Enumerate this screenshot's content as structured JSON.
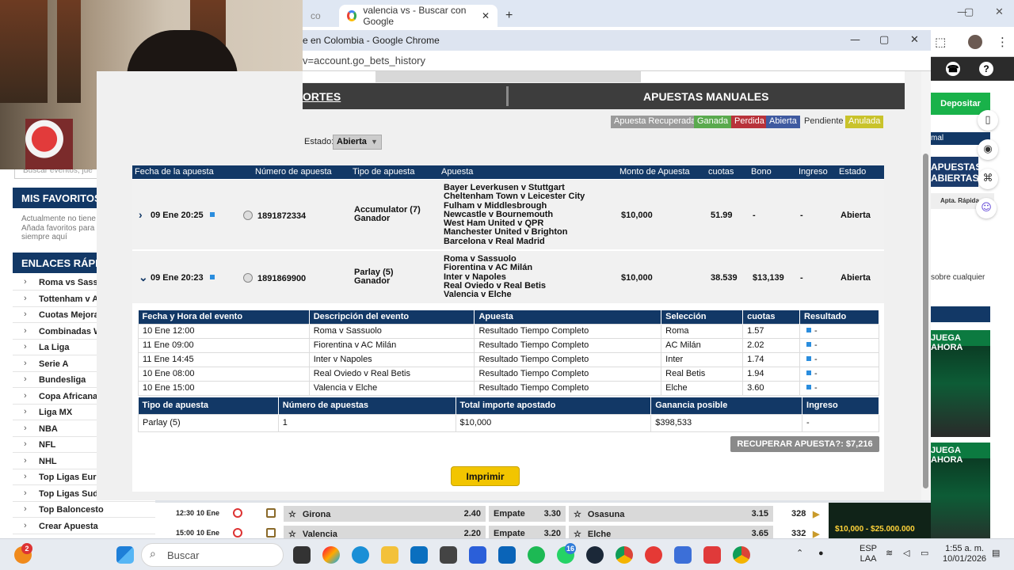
{
  "browser": {
    "tab_partial": "co",
    "tab_active_title": "valencia vs - Buscar con Google",
    "new_tab": "+",
    "win_min": "—",
    "win_max": "▢",
    "win_close": "✕"
  },
  "popup": {
    "title": "e en Colombia - Google Chrome",
    "url": "v=account.go_bets_history",
    "min": "—",
    "max": "▢",
    "close": "✕"
  },
  "site": {
    "search_placeholder": "Buscar eventos, jue",
    "favoritos_header": "MIS FAVORITOS",
    "favoritos_text": "Actualmente no tiene Añada favoritos para siempre aquí",
    "enlaces_header": "ENLACES RÁPID",
    "links": [
      "Roma vs Sassu",
      "Tottenham v As",
      "Cuotas Mejorac",
      "Combinadas W",
      "La Liga",
      "Serie A",
      "Bundesliga",
      "Copa Africana -",
      "Liga MX",
      "NBA",
      "NFL",
      "NHL",
      "Top Ligas Euro",
      "Top Ligas Suda",
      "Top Baloncesto",
      "Crear Apuesta"
    ],
    "right": {
      "phone_icon": "☎",
      "help": "?",
      "depositar": "Depositar",
      "balance_text": "mal",
      "apuestas_abiertas": "APUESTAS ABIERTAS",
      "apt_rapida": "Apta. Rápida",
      "sobre": "sobre cualquier",
      "juega_ahora_1": "JUEGA AHORA",
      "juega_ahora_2": "JUEGA AHORA"
    },
    "matches": [
      {
        "time": "12:30",
        "date": "10 Ene",
        "home": "Girona",
        "home_odds": "2.40",
        "draw": "Empate",
        "draw_odds": "3.30",
        "away": "Osasuna",
        "away_odds": "3.15",
        "count": "328"
      },
      {
        "time": "15:00",
        "date": "10 Ene",
        "home": "Valencia",
        "home_odds": "2.20",
        "draw": "Empate",
        "draw_odds": "3.20",
        "away": "Elche",
        "away_odds": "3.65",
        "count": "332"
      }
    ],
    "promo": "$10,000 - $25.000.000"
  },
  "tabs": {
    "deportes": "ORTES",
    "manuales": "APUESTAS MANUALES"
  },
  "legend": [
    {
      "label": "Apuesta Recuperada",
      "color": "#9a9a9a"
    },
    {
      "label": "Ganada",
      "color": "#5aaa4e"
    },
    {
      "label": "Perdida",
      "color": "#b8323a"
    },
    {
      "label": "Abierta",
      "color": "#3f5aa0"
    },
    {
      "label": "Pendiente",
      "color": "none"
    },
    {
      "label": "Anulada",
      "color": "#c9c32b"
    }
  ],
  "filter": {
    "estado_label": "Estado:",
    "estado_value": "Abierta"
  },
  "bets_table": {
    "headers": [
      "Fecha de la apuesta",
      "Número de apuesta",
      "Tipo de apuesta",
      "Apuesta",
      "Monto de Apuesta",
      "cuotas",
      "Bono",
      "Ingreso",
      "Estado"
    ],
    "rows": [
      {
        "expand_icon": "›",
        "date": "09 Ene 20:25",
        "number": "1891872334",
        "type_line1": "Accumulator (7)",
        "type_line2": "Ganador",
        "events": [
          "Bayer Leverkusen v Stuttgart",
          "Cheltenham Town v Leicester City",
          "Fulham v Middlesbrough",
          "Newcastle v Bournemouth",
          "West Ham United v QPR",
          "Manchester United v Brighton",
          "Barcelona v Real Madrid"
        ],
        "amount": "$10,000",
        "odds": "51.99",
        "bonus": "-",
        "income": "-",
        "status": "Abierta"
      },
      {
        "expand_icon": "⌄",
        "date": "09 Ene 20:23",
        "number": "1891869900",
        "type_line1": "Parlay (5)",
        "type_line2": "Ganador",
        "events": [
          "Roma v Sassuolo",
          "Fiorentina v AC Milán",
          "Inter v Napoles",
          "Real Oviedo v Real Betis",
          "Valencia v Elche"
        ],
        "amount": "$10,000",
        "odds": "38.539",
        "bonus": "$13,139",
        "income": "-",
        "status": "Abierta"
      }
    ]
  },
  "details_table": {
    "headers": [
      "Fecha y Hora del evento",
      "Descripción del evento",
      "Apuesta",
      "Selección",
      "cuotas",
      "Resultado"
    ],
    "rows": [
      [
        "10 Ene 12:00",
        "Roma v Sassuolo",
        "Resultado Tiempo Completo",
        "Roma",
        "1.57",
        "-"
      ],
      [
        "11 Ene 09:00",
        "Fiorentina v AC Milán",
        "Resultado Tiempo Completo",
        "AC Milán",
        "2.02",
        "-"
      ],
      [
        "11 Ene 14:45",
        "Inter v Napoles",
        "Resultado Tiempo Completo",
        "Inter",
        "1.74",
        "-"
      ],
      [
        "10 Ene 08:00",
        "Real Oviedo v Real Betis",
        "Resultado Tiempo Completo",
        "Real Betis",
        "1.94",
        "-"
      ],
      [
        "10 Ene 15:00",
        "Valencia v Elche",
        "Resultado Tiempo Completo",
        "Elche",
        "3.60",
        "-"
      ]
    ]
  },
  "summary_table": {
    "headers": [
      "Tipo de apuesta",
      "Número de apuestas",
      "Total importe apostado",
      "Ganancia posible",
      "Ingreso"
    ],
    "row": [
      "Parlay (5)",
      "1",
      "$10,000",
      "$398,533",
      "-"
    ]
  },
  "recuperar_label": "RECUPERAR APUESTA?: $7,216",
  "imprimir_label": "Imprimir",
  "taskbar": {
    "search": "Buscar",
    "lang_line1": "ESP",
    "lang_line2": "LAA",
    "time": "1:55 a. m.",
    "date": "10/01/2026",
    "badge_left": "2",
    "badge_whatsapp": "16"
  }
}
